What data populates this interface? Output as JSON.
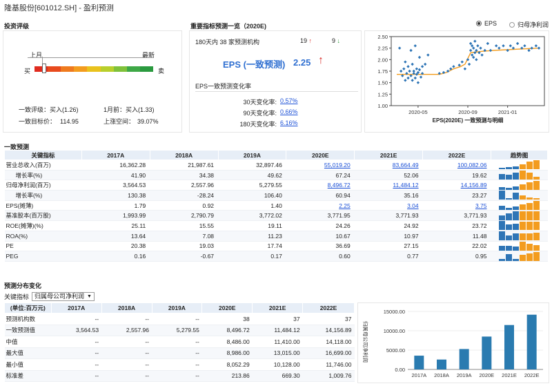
{
  "header": {
    "title": "隆基股份[601012.SH] - 盈利预测"
  },
  "rating": {
    "section_title": "投资评级",
    "last_month": "上月",
    "latest": "最新",
    "buy": "买",
    "sell": "卖",
    "gauge_colors": [
      "#e02b1f",
      "#e84a1d",
      "#ef7a1e",
      "#f39c1e",
      "#e9c21d",
      "#b8cf2b",
      "#7fc13a",
      "#3ea846",
      "#2a9a3f"
    ],
    "consensus_label": "一致评级：",
    "consensus_value": "买入(1.26)",
    "month_ago_label": "1月前：",
    "month_ago_value": "买入(1.33)",
    "target_label": "一致目标价：",
    "target_value": "114.95",
    "upside_label": "上涨空间：",
    "upside_value": "39.07%"
  },
  "indicators": {
    "section_title": "重要指标预测一览（2020E)",
    "institutions": "180天内 38 家预测机构",
    "up_count": "19",
    "down_count": "9",
    "eps_label": "EPS (一致预测)",
    "eps_value": "2.25",
    "change_title": "EPS一致预测变化率",
    "changes": [
      {
        "label": "30天变化率:",
        "value": "0.57%"
      },
      {
        "label": "90天变化率:",
        "value": "0.66%"
      },
      {
        "label": "180天变化率:",
        "value": "6.16%"
      }
    ]
  },
  "radio": {
    "eps": "EPS",
    "net_profit": "归母净利润"
  },
  "scatter": {
    "xlabel": "EPS(2020E) 一致预测与明细",
    "yticks": [
      "2.50",
      "2.25",
      "2.00",
      "1.75",
      "1.50",
      "1.25",
      "1.00"
    ],
    "xticks": [
      "2020-05",
      "2020-09",
      "2021-01"
    ],
    "chart_data": {
      "type": "scatter",
      "ylim": [
        1.0,
        2.5
      ],
      "consensus_line": [
        [
          0,
          1.68
        ],
        [
          0.3,
          1.68
        ],
        [
          0.35,
          1.72
        ],
        [
          0.4,
          1.8
        ],
        [
          0.45,
          1.85
        ],
        [
          0.48,
          1.9
        ],
        [
          0.52,
          2.15
        ],
        [
          0.6,
          2.18
        ],
        [
          0.68,
          2.2
        ],
        [
          1,
          2.25
        ]
      ],
      "points": [
        [
          0.02,
          2.25
        ],
        [
          0.03,
          1.75
        ],
        [
          0.04,
          1.65
        ],
        [
          0.05,
          1.8
        ],
        [
          0.06,
          1.55
        ],
        [
          0.06,
          1.95
        ],
        [
          0.07,
          1.7
        ],
        [
          0.08,
          1.6
        ],
        [
          0.08,
          1.85
        ],
        [
          0.09,
          1.75
        ],
        [
          0.1,
          2.2
        ],
        [
          0.1,
          1.65
        ],
        [
          0.11,
          1.55
        ],
        [
          0.11,
          1.9
        ],
        [
          0.12,
          1.7
        ],
        [
          0.12,
          1.75
        ],
        [
          0.13,
          2.3
        ],
        [
          0.13,
          1.6
        ],
        [
          0.14,
          1.8
        ],
        [
          0.14,
          1.68
        ],
        [
          0.15,
          1.72
        ],
        [
          0.15,
          1.5
        ],
        [
          0.16,
          1.78
        ],
        [
          0.16,
          2.05
        ],
        [
          0.17,
          1.62
        ],
        [
          0.18,
          1.7
        ],
        [
          0.18,
          1.85
        ],
        [
          0.2,
          1.9
        ],
        [
          0.22,
          2.1
        ],
        [
          0.3,
          1.7
        ],
        [
          0.33,
          1.72
        ],
        [
          0.36,
          1.75
        ],
        [
          0.38,
          1.8
        ],
        [
          0.4,
          1.85
        ],
        [
          0.44,
          1.88
        ],
        [
          0.46,
          1.95
        ],
        [
          0.48,
          1.8
        ],
        [
          0.5,
          2.0
        ],
        [
          0.51,
          1.9
        ],
        [
          0.52,
          2.2
        ],
        [
          0.52,
          2.35
        ],
        [
          0.53,
          2.1
        ],
        [
          0.53,
          2.3
        ],
        [
          0.54,
          2.05
        ],
        [
          0.54,
          2.25
        ],
        [
          0.55,
          2.15
        ],
        [
          0.55,
          2.4
        ],
        [
          0.56,
          2.2
        ],
        [
          0.56,
          2.0
        ],
        [
          0.57,
          2.3
        ],
        [
          0.58,
          2.15
        ],
        [
          0.59,
          2.25
        ],
        [
          0.6,
          2.1
        ],
        [
          0.62,
          2.2
        ],
        [
          0.64,
          2.35
        ],
        [
          0.66,
          2.2
        ],
        [
          0.7,
          2.3
        ],
        [
          0.72,
          2.25
        ],
        [
          0.75,
          2.3
        ],
        [
          0.78,
          2.2
        ],
        [
          0.8,
          2.3
        ],
        [
          0.82,
          2.25
        ],
        [
          0.85,
          2.35
        ],
        [
          0.88,
          2.25
        ],
        [
          0.9,
          2.3
        ],
        [
          0.93,
          2.2
        ],
        [
          0.95,
          2.25
        ],
        [
          0.98,
          2.3
        ],
        [
          1.0,
          2.25
        ]
      ]
    }
  },
  "forecast": {
    "section_title": "一致预测",
    "headers": [
      "关键指标",
      "2017A",
      "2018A",
      "2019A",
      "2020E",
      "2021E",
      "2022E",
      "趋势图"
    ],
    "rows": [
      {
        "label": "营业总收入(百万)",
        "ind": false,
        "v": [
          "16,362.28",
          "21,987.61",
          "32,897.46",
          "55,019.20",
          "83,664.49",
          "100,082.06"
        ],
        "link": [
          3,
          4,
          5
        ],
        "trend": [
          0.16,
          0.22,
          0.33,
          0.55,
          0.84,
          1.0
        ],
        "cols": [
          "#2e75b6",
          "#2e75b6",
          "#2e75b6",
          "#f39c1e",
          "#f39c1e",
          "#f39c1e"
        ]
      },
      {
        "label": "增长率(%)",
        "ind": true,
        "v": [
          "41.90",
          "34.38",
          "49.62",
          "67.24",
          "52.06",
          "19.62"
        ],
        "link": [],
        "trend": [
          0.62,
          0.51,
          0.74,
          1.0,
          0.77,
          0.29
        ],
        "cols": [
          "#2e75b6",
          "#2e75b6",
          "#2e75b6",
          "#f39c1e",
          "#f39c1e",
          "#f39c1e"
        ]
      },
      {
        "label": "归母净利润(百万)",
        "ind": false,
        "v": [
          "3,564.53",
          "2,557.96",
          "5,279.55",
          "8,496.72",
          "11,484.12",
          "14,156.89"
        ],
        "link": [
          3,
          4,
          5
        ],
        "trend": [
          0.25,
          0.18,
          0.37,
          0.6,
          0.81,
          1.0
        ],
        "cols": [
          "#2e75b6",
          "#2e75b6",
          "#2e75b6",
          "#f39c1e",
          "#f39c1e",
          "#f39c1e"
        ]
      },
      {
        "label": "增长率(%)",
        "ind": true,
        "v": [
          "130.38",
          "-28.24",
          "106.40",
          "60.94",
          "35.16",
          "23.27"
        ],
        "link": [],
        "trend": [
          1.0,
          0.22,
          0.82,
          0.47,
          0.27,
          0.18
        ],
        "cols": [
          "#2e75b6",
          "#2e75b6",
          "#2e75b6",
          "#f39c1e",
          "#f39c1e",
          "#f39c1e"
        ]
      },
      {
        "label": "EPS(摊薄)",
        "ind": false,
        "v": [
          "1.79",
          "0.92",
          "1.40",
          "2.25",
          "3.04",
          "3.75"
        ],
        "link": [
          3,
          4,
          5
        ],
        "trend": [
          0.48,
          0.25,
          0.37,
          0.6,
          0.81,
          1.0
        ],
        "cols": [
          "#2e75b6",
          "#2e75b6",
          "#2e75b6",
          "#f39c1e",
          "#f39c1e",
          "#f39c1e"
        ]
      },
      {
        "label": "基准股本(百万股)",
        "ind": false,
        "v": [
          "1,993.99",
          "2,790.79",
          "3,772.02",
          "3,771.95",
          "3,771.93",
          "3,771.93"
        ],
        "link": [],
        "trend": [
          0.53,
          0.74,
          1.0,
          1.0,
          1.0,
          1.0
        ],
        "cols": [
          "#2e75b6",
          "#2e75b6",
          "#2e75b6",
          "#f39c1e",
          "#f39c1e",
          "#f39c1e"
        ]
      },
      {
        "label": "ROE(摊薄)(%)",
        "ind": false,
        "v": [
          "25.11",
          "15.55",
          "19.11",
          "24.26",
          "24.92",
          "23.72"
        ],
        "link": [],
        "trend": [
          1.0,
          0.62,
          0.76,
          0.97,
          0.99,
          0.94
        ],
        "cols": [
          "#2e75b6",
          "#2e75b6",
          "#2e75b6",
          "#f39c1e",
          "#f39c1e",
          "#f39c1e"
        ]
      },
      {
        "label": "ROA(%)",
        "ind": false,
        "v": [
          "13.64",
          "7.08",
          "11.23",
          "10.67",
          "10.97",
          "11.48"
        ],
        "link": [],
        "trend": [
          1.0,
          0.52,
          0.82,
          0.78,
          0.8,
          0.84
        ],
        "cols": [
          "#2e75b6",
          "#2e75b6",
          "#2e75b6",
          "#f39c1e",
          "#f39c1e",
          "#f39c1e"
        ]
      },
      {
        "label": "PE",
        "ind": false,
        "v": [
          "20.38",
          "19.03",
          "17.74",
          "36.69",
          "27.15",
          "22.02"
        ],
        "link": [],
        "trend": [
          0.56,
          0.52,
          0.48,
          1.0,
          0.74,
          0.6
        ],
        "cols": [
          "#2e75b6",
          "#2e75b6",
          "#2e75b6",
          "#f39c1e",
          "#f39c1e",
          "#f39c1e"
        ]
      },
      {
        "label": "PEG",
        "ind": false,
        "v": [
          "0.16",
          "-0.67",
          "0.17",
          "0.60",
          "0.77",
          "0.95"
        ],
        "link": [],
        "trend": [
          0.17,
          0.7,
          0.18,
          0.63,
          0.81,
          1.0
        ],
        "cols": [
          "#2e75b6",
          "#2e75b6",
          "#2e75b6",
          "#f39c1e",
          "#f39c1e",
          "#f39c1e"
        ]
      }
    ]
  },
  "distribution": {
    "section_title": "预测分布变化",
    "key_label": "关键指标",
    "select_value": "归属母公司净利润",
    "headers": [
      "(单位:百万元)",
      "2017A",
      "2018A",
      "2019A",
      "2020E",
      "2021E",
      "2022E"
    ],
    "rows": [
      {
        "label": "预测机构数",
        "v": [
          "--",
          "--",
          "--",
          "38",
          "37",
          "37"
        ]
      },
      {
        "label": "一致预测值",
        "v": [
          "3,564.53",
          "2,557.96",
          "5,279.55",
          "8,496.72",
          "11,484.12",
          "14,156.89"
        ]
      },
      {
        "label": "中值",
        "v": [
          "--",
          "--",
          "--",
          "8,486.00",
          "11,410.00",
          "14,118.00"
        ]
      },
      {
        "label": "最大值",
        "v": [
          "--",
          "--",
          "--",
          "8,986.00",
          "13,015.00",
          "16,699.00"
        ]
      },
      {
        "label": "最小值",
        "v": [
          "--",
          "--",
          "--",
          "8,052.29",
          "10,128.00",
          "11,746.00"
        ]
      },
      {
        "label": "标准差",
        "v": [
          "--",
          "--",
          "--",
          "213.86",
          "669.30",
          "1,009.76"
        ]
      }
    ]
  },
  "bar_chart": {
    "ylabel": "归属母公司净利润",
    "yticks": [
      "15000.00",
      "10000.00",
      "5000.00",
      "0.00"
    ],
    "color": "#2a7bb0",
    "chart_data": {
      "type": "bar",
      "categories": [
        "2017A",
        "2018A",
        "2019A",
        "2020E",
        "2021E",
        "2022E"
      ],
      "values": [
        3564.53,
        2557.96,
        5279.55,
        8496.72,
        11484.12,
        14156.89
      ],
      "ylim": [
        0,
        15000
      ],
      "ylabel": "归属母公司净利润"
    }
  }
}
